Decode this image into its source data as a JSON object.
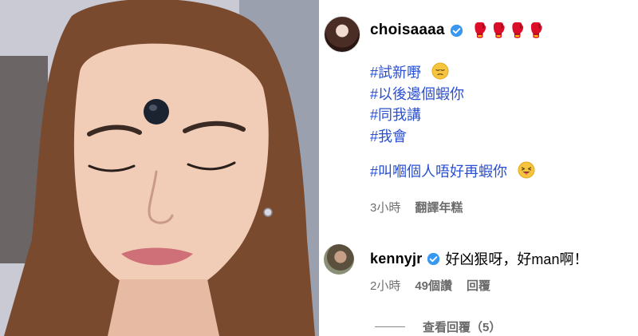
{
  "post": {
    "author": {
      "username": "choisaaaa",
      "verified": true,
      "badge_icons": [
        "boxing-glove-icon",
        "boxing-glove-icon",
        "boxing-glove-icon",
        "boxing-glove-icon"
      ]
    },
    "caption_lines": [
      "#試新嘢",
      "#以後邊個蝦你",
      "#同我講",
      "#我會",
      "#叫嗰個人唔好再蝦你"
    ],
    "caption_emojis": [
      "pensive-face-emoji",
      "winking-tongue-face-emoji"
    ],
    "time": "3小時",
    "translate_label": "翻譯年糕"
  },
  "reply": {
    "username": "kennyjr",
    "verified": true,
    "text": "好凶狠呀，好man啊！",
    "time": "2小時",
    "views": "49個讚",
    "reply_label": "回覆"
  },
  "view_replies_label": "查看回覆（5）",
  "colors": {
    "hashtag": "#2a4fd0",
    "verified_badge": "#3897f0",
    "meta_text": "#6f6f6f",
    "glove": "#d91e26"
  }
}
